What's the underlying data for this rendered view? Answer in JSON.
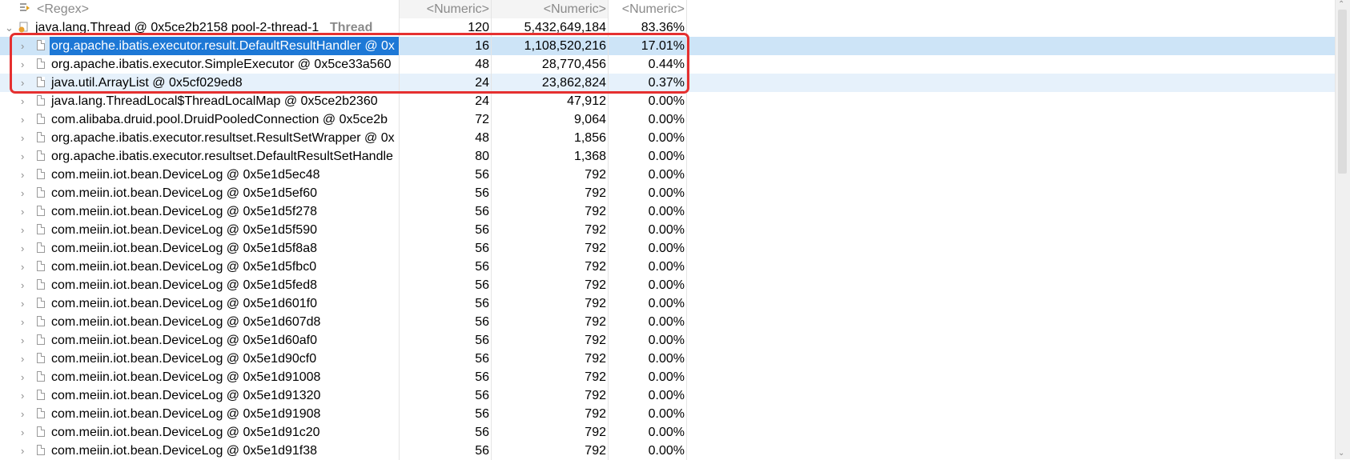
{
  "header": {
    "col0": "<Regex>",
    "col1": "<Numeric>",
    "col2": "<Numeric>",
    "col3": "<Numeric>"
  },
  "root": {
    "name": "java.lang.Thread @ 0x5ce2b2158  pool-2-thread-1",
    "suffix": "Thread",
    "v1": "120",
    "v2": "5,432,649,184",
    "v3": "83.36%"
  },
  "rows": [
    {
      "name": "org.apache.ibatis.executor.result.DefaultResultHandler @ 0x",
      "v1": "16",
      "v2": "1,108,520,216",
      "v3": "17.01%"
    },
    {
      "name": "org.apache.ibatis.executor.SimpleExecutor @ 0x5ce33a560",
      "v1": "48",
      "v2": "28,770,456",
      "v3": "0.44%"
    },
    {
      "name": "java.util.ArrayList @ 0x5cf029ed8",
      "v1": "24",
      "v2": "23,862,824",
      "v3": "0.37%"
    },
    {
      "name": "java.lang.ThreadLocal$ThreadLocalMap @ 0x5ce2b2360",
      "v1": "24",
      "v2": "47,912",
      "v3": "0.00%"
    },
    {
      "name": "com.alibaba.druid.pool.DruidPooledConnection @ 0x5ce2b",
      "v1": "72",
      "v2": "9,064",
      "v3": "0.00%"
    },
    {
      "name": "org.apache.ibatis.executor.resultset.ResultSetWrapper @ 0x",
      "v1": "48",
      "v2": "1,856",
      "v3": "0.00%"
    },
    {
      "name": "org.apache.ibatis.executor.resultset.DefaultResultSetHandle",
      "v1": "80",
      "v2": "1,368",
      "v3": "0.00%"
    },
    {
      "name": "com.meiin.iot.bean.DeviceLog @ 0x5e1d5ec48",
      "v1": "56",
      "v2": "792",
      "v3": "0.00%"
    },
    {
      "name": "com.meiin.iot.bean.DeviceLog @ 0x5e1d5ef60",
      "v1": "56",
      "v2": "792",
      "v3": "0.00%"
    },
    {
      "name": "com.meiin.iot.bean.DeviceLog @ 0x5e1d5f278",
      "v1": "56",
      "v2": "792",
      "v3": "0.00%"
    },
    {
      "name": "com.meiin.iot.bean.DeviceLog @ 0x5e1d5f590",
      "v1": "56",
      "v2": "792",
      "v3": "0.00%"
    },
    {
      "name": "com.meiin.iot.bean.DeviceLog @ 0x5e1d5f8a8",
      "v1": "56",
      "v2": "792",
      "v3": "0.00%"
    },
    {
      "name": "com.meiin.iot.bean.DeviceLog @ 0x5e1d5fbc0",
      "v1": "56",
      "v2": "792",
      "v3": "0.00%"
    },
    {
      "name": "com.meiin.iot.bean.DeviceLog @ 0x5e1d5fed8",
      "v1": "56",
      "v2": "792",
      "v3": "0.00%"
    },
    {
      "name": "com.meiin.iot.bean.DeviceLog @ 0x5e1d601f0",
      "v1": "56",
      "v2": "792",
      "v3": "0.00%"
    },
    {
      "name": "com.meiin.iot.bean.DeviceLog @ 0x5e1d607d8",
      "v1": "56",
      "v2": "792",
      "v3": "0.00%"
    },
    {
      "name": "com.meiin.iot.bean.DeviceLog @ 0x5e1d60af0",
      "v1": "56",
      "v2": "792",
      "v3": "0.00%"
    },
    {
      "name": "com.meiin.iot.bean.DeviceLog @ 0x5e1d90cf0",
      "v1": "56",
      "v2": "792",
      "v3": "0.00%"
    },
    {
      "name": "com.meiin.iot.bean.DeviceLog @ 0x5e1d91008",
      "v1": "56",
      "v2": "792",
      "v3": "0.00%"
    },
    {
      "name": "com.meiin.iot.bean.DeviceLog @ 0x5e1d91320",
      "v1": "56",
      "v2": "792",
      "v3": "0.00%"
    },
    {
      "name": "com.meiin.iot.bean.DeviceLog @ 0x5e1d91908",
      "v1": "56",
      "v2": "792",
      "v3": "0.00%"
    },
    {
      "name": "com.meiin.iot.bean.DeviceLog @ 0x5e1d91c20",
      "v1": "56",
      "v2": "792",
      "v3": "0.00%"
    },
    {
      "name": "com.meiin.iot.bean.DeviceLog @ 0x5e1d91f38",
      "v1": "56",
      "v2": "792",
      "v3": "0.00%"
    }
  ],
  "colors": {
    "selection": "#1d78d6",
    "row_highlight": "#e6f1fb",
    "annotation_box": "#e53030"
  }
}
